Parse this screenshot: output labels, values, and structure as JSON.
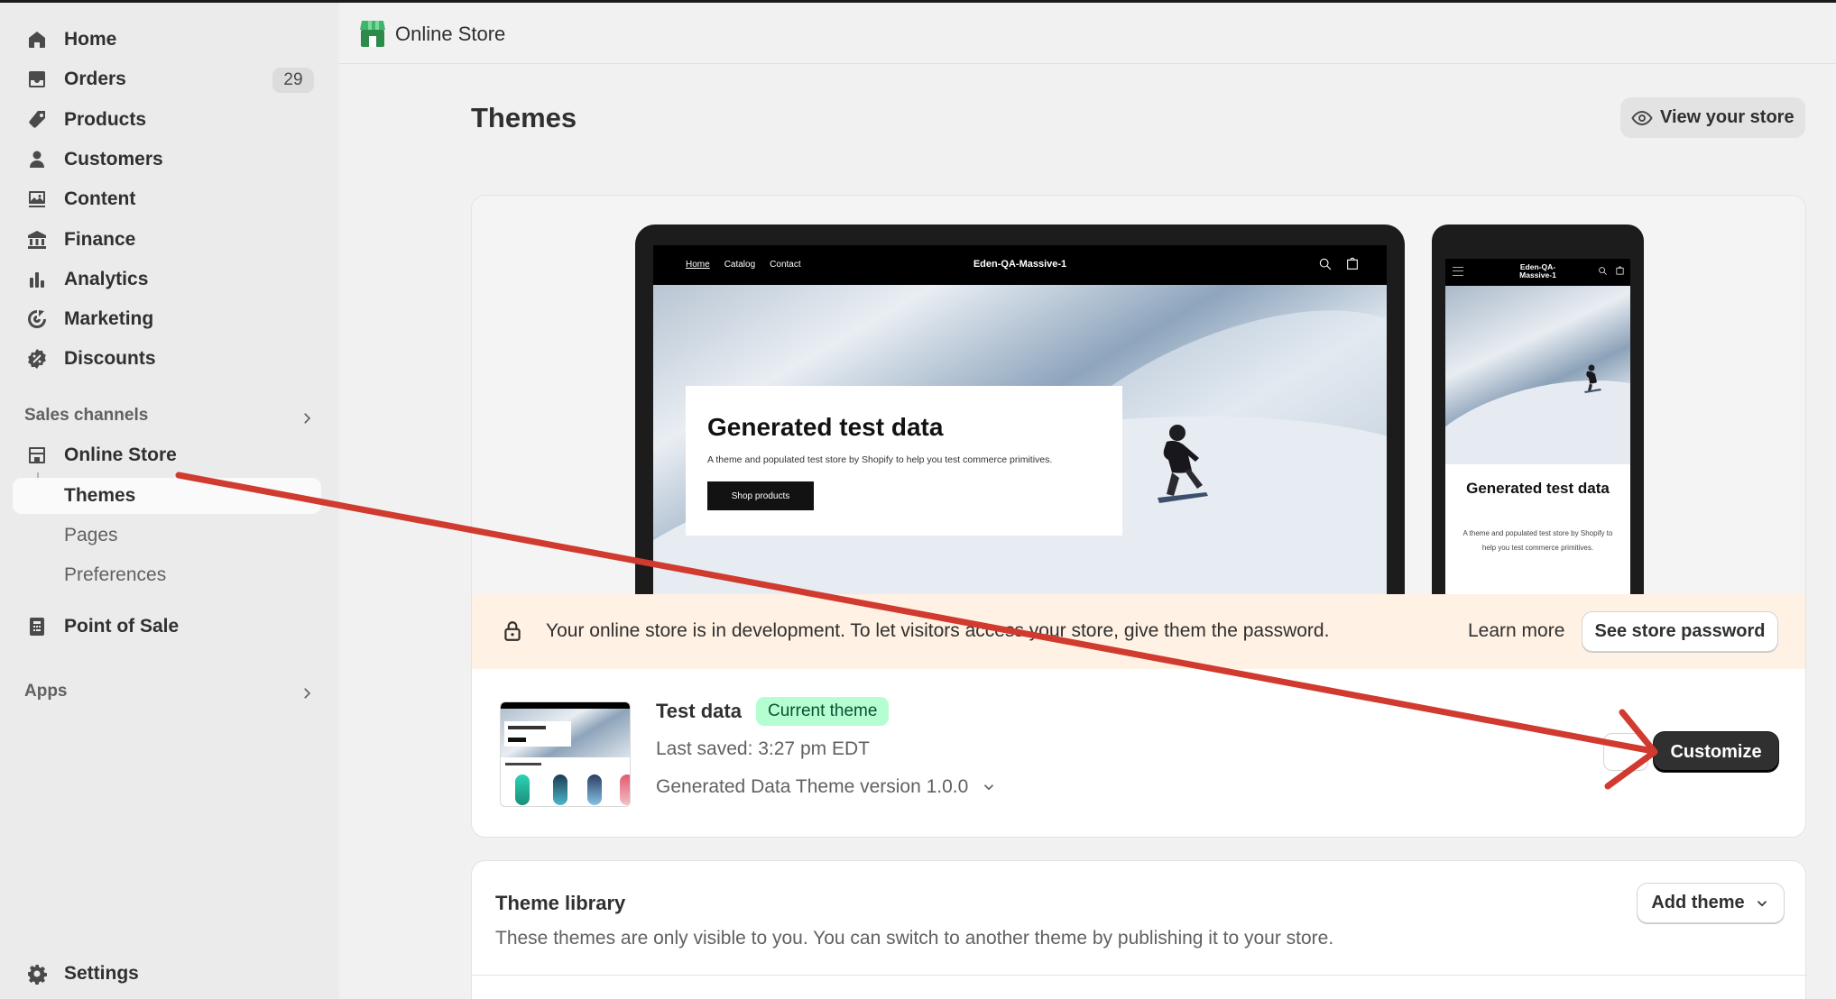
{
  "sidebar": {
    "items": [
      {
        "label": "Home",
        "icon": "home-icon"
      },
      {
        "label": "Orders",
        "icon": "inbox-icon",
        "badge": "29"
      },
      {
        "label": "Products",
        "icon": "tag-icon"
      },
      {
        "label": "Customers",
        "icon": "person-icon"
      },
      {
        "label": "Content",
        "icon": "image-icon"
      },
      {
        "label": "Finance",
        "icon": "bank-icon"
      },
      {
        "label": "Analytics",
        "icon": "bar-chart-icon"
      },
      {
        "label": "Marketing",
        "icon": "target-icon"
      },
      {
        "label": "Discounts",
        "icon": "discount-icon"
      }
    ],
    "sales_channels_label": "Sales channels",
    "online_store_label": "Online Store",
    "sub_items": [
      {
        "label": "Themes"
      },
      {
        "label": "Pages"
      },
      {
        "label": "Preferences"
      }
    ],
    "pos_label": "Point of Sale",
    "apps_label": "Apps",
    "settings_label": "Settings"
  },
  "topbar": {
    "title": "Online Store"
  },
  "page": {
    "title": "Themes",
    "view_store_label": "View your store"
  },
  "preview": {
    "desktop": {
      "nav_links": [
        "Home",
        "Catalog",
        "Contact"
      ],
      "brand": "Eden-QA-Massive-1",
      "hero_title": "Generated test data",
      "hero_desc": "A theme and populated test store by Shopify to help you test commerce primitives.",
      "hero_button": "Shop products"
    },
    "mobile": {
      "brand": "Eden-QA-\nMassive-1",
      "hero_title": "Generated test data",
      "hero_desc": "A theme and populated test store by Shopify to help you test commerce primitives."
    }
  },
  "dev_banner": {
    "message": "Your online store is in development. To let visitors access your store, give them the password.",
    "learn_more": "Learn more",
    "password_button": "See store password"
  },
  "current_theme": {
    "name": "Test data",
    "badge": "Current theme",
    "last_saved": "Last saved: 3:27 pm EDT",
    "version": "Generated Data Theme version 1.0.0",
    "customize_label": "Customize"
  },
  "theme_library": {
    "title": "Theme library",
    "description": "These themes are only visible to you. You can switch to another theme by publishing it to your store.",
    "add_theme_label": "Add theme"
  },
  "colors": {
    "accent_green": "#b4fed2",
    "banner_bg": "#fff1e3",
    "annotation_red": "#d03a2f",
    "primary_button": "#303030"
  }
}
